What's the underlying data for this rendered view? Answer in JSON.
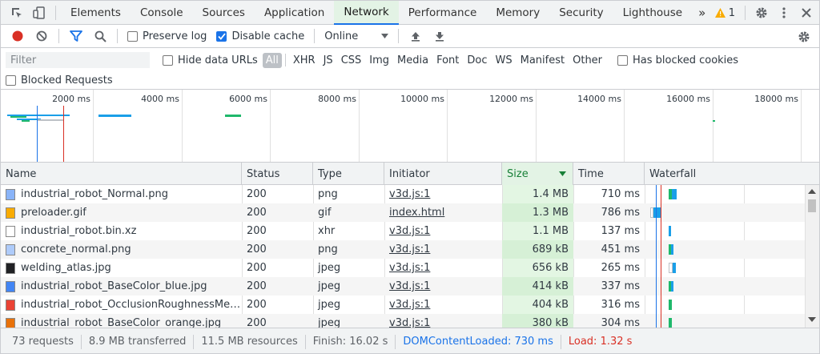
{
  "tabs": [
    {
      "label": "Elements"
    },
    {
      "label": "Console"
    },
    {
      "label": "Sources"
    },
    {
      "label": "Application"
    },
    {
      "label": "Network"
    },
    {
      "label": "Performance"
    },
    {
      "label": "Memory"
    },
    {
      "label": "Security"
    },
    {
      "label": "Lighthouse"
    }
  ],
  "active_tab": "Network",
  "more_tabs_glyph": "»",
  "warnings": {
    "count": "1"
  },
  "toolbar": {
    "preserve_log": {
      "label": "Preserve log",
      "checked": false
    },
    "disable_cache": {
      "label": "Disable cache",
      "checked": true
    },
    "throttling": {
      "value": "Online"
    }
  },
  "filter": {
    "placeholder": "Filter",
    "hide_data_urls": {
      "label": "Hide data URLs",
      "checked": false
    },
    "types": [
      "All",
      "XHR",
      "JS",
      "CSS",
      "Img",
      "Media",
      "Font",
      "Doc",
      "WS",
      "Manifest",
      "Other"
    ],
    "active_type": "All",
    "has_blocked_cookies": {
      "label": "Has blocked cookies",
      "checked": false
    },
    "blocked_requests": {
      "label": "Blocked Requests",
      "checked": false
    }
  },
  "overview": {
    "labels": [
      "2000 ms",
      "4000 ms",
      "6000 ms",
      "8000 ms",
      "10000 ms",
      "12000 ms",
      "14000 ms",
      "16000 ms",
      "18000 ms"
    ]
  },
  "table": {
    "columns": [
      "Name",
      "Status",
      "Type",
      "Initiator",
      "Size",
      "Time",
      "Waterfall"
    ],
    "sorted_column": "Size",
    "rows": [
      {
        "name": "industrial_robot_Normal.png",
        "status": "200",
        "type": "png",
        "initiator": "v3d.js:1",
        "size": "1.4 MB",
        "time": "710 ms",
        "icon_color": "#8ab4f8"
      },
      {
        "name": "preloader.gif",
        "status": "200",
        "type": "gif",
        "initiator": "index.html",
        "size": "1.3 MB",
        "time": "786 ms",
        "icon_color": "#f9ab00"
      },
      {
        "name": "industrial_robot.bin.xz",
        "status": "200",
        "type": "xhr",
        "initiator": "v3d.js:1",
        "size": "1.1 MB",
        "time": "137 ms",
        "icon_color": "#ffffff"
      },
      {
        "name": "concrete_normal.png",
        "status": "200",
        "type": "png",
        "initiator": "v3d.js:1",
        "size": "689 kB",
        "time": "451 ms",
        "icon_color": "#aecbfa"
      },
      {
        "name": "welding_atlas.jpg",
        "status": "200",
        "type": "jpeg",
        "initiator": "v3d.js:1",
        "size": "656 kB",
        "time": "265 ms",
        "icon_color": "#202124"
      },
      {
        "name": "industrial_robot_BaseColor_blue.jpg",
        "status": "200",
        "type": "jpeg",
        "initiator": "v3d.js:1",
        "size": "414 kB",
        "time": "337 ms",
        "icon_color": "#4285f4"
      },
      {
        "name": "industrial_robot_OcclusionRoughnessMetal…",
        "status": "200",
        "type": "jpeg",
        "initiator": "v3d.js:1",
        "size": "404 kB",
        "time": "316 ms",
        "icon_color": "#ea4335"
      },
      {
        "name": "industrial_robot_BaseColor_orange.jpg",
        "status": "200",
        "type": "jpeg",
        "initiator": "v3d.js:1",
        "size": "380 kB",
        "time": "304 ms",
        "icon_color": "#e8710a"
      }
    ]
  },
  "status": {
    "requests": "73 requests",
    "transferred": "8.9 MB transferred",
    "resources": "11.5 MB resources",
    "finish": "Finish: 16.02 s",
    "dom_content_loaded": "DOMContentLoaded: 730 ms",
    "load": "Load: 1.32 s"
  },
  "colors": {
    "accent": "#1a73e8",
    "record": "#d93025",
    "dcl_line": "#1a73e8",
    "load_line": "#d93025",
    "waterfall_blue": "#1a9fe8",
    "waterfall_green": "#1fb86b",
    "sorted_bg": "#e3f6e3"
  }
}
